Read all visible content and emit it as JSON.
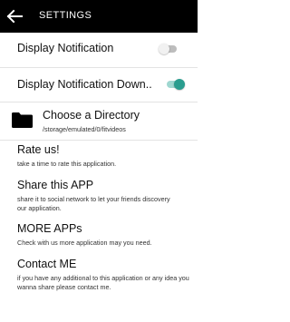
{
  "toolbar": {
    "title": "SETTINGS",
    "back_icon": "arrow-left-icon"
  },
  "settings": {
    "display_notification": {
      "label": "Display Notification",
      "enabled": false
    },
    "display_notification_download": {
      "label": "Display Notification Down..",
      "enabled": true
    },
    "directory": {
      "label": "Choose a Directory",
      "path": "/storage/emulated/0/fitvideos",
      "icon": "folder-icon"
    },
    "rate": {
      "label": "Rate us!",
      "description": "take a time to rate this application."
    },
    "share": {
      "label": "Share this APP",
      "description": "share it to social network to let your friends discovery our application."
    },
    "more": {
      "label": "MORE APPs",
      "description": "Check with us more application may you need."
    },
    "contact": {
      "label": "Contact ME",
      "description": "if you have any additional to this application or any idea you wanna share please contact me."
    }
  },
  "colors": {
    "toolbar": "#000000",
    "accent": "#2a9d8f",
    "switch_off": "#bdbdbd"
  }
}
